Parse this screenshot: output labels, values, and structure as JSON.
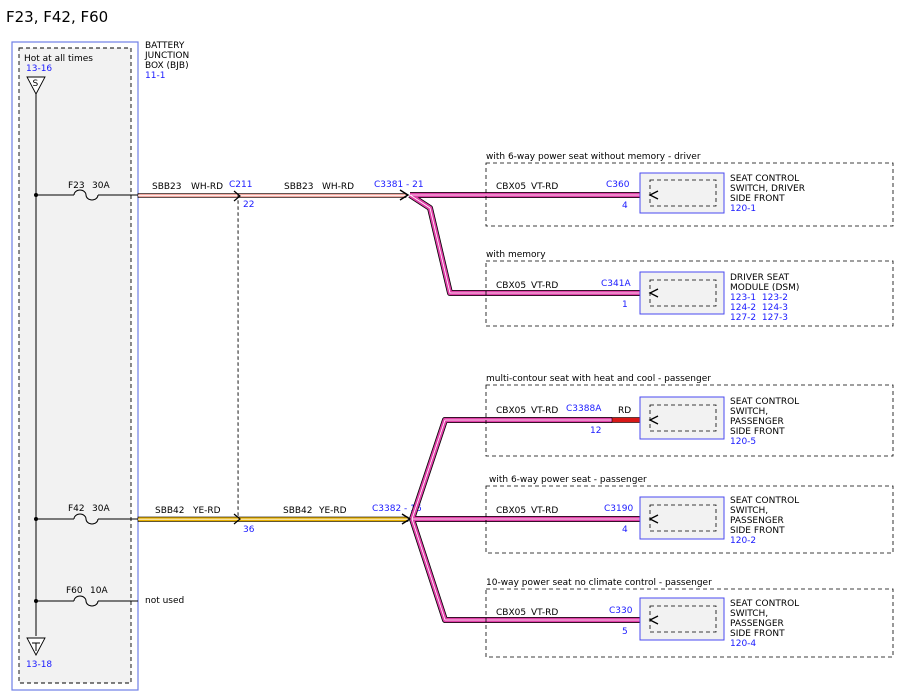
{
  "title": "F23, F42, F60",
  "bjb": {
    "hot_label": "Hot at all times",
    "ref_top": "13-16",
    "ref_bottom": "13-18",
    "s_label": "S",
    "name_lines": [
      "BATTERY",
      "JUNCTION",
      "BOX (BJB)"
    ],
    "name_ref": "11-1"
  },
  "fuses": [
    {
      "id": "F23",
      "amps": "30A"
    },
    {
      "id": "F42",
      "amps": "30A"
    },
    {
      "id": "F60",
      "amps": "10A",
      "note": "not used"
    }
  ],
  "circuits": {
    "top": {
      "left_circuit": "SBB23",
      "left_color": "WH-RD",
      "mid_connector": "C211",
      "mid_pin": "22",
      "right_circuit": "SBB23",
      "right_color": "WH-RD",
      "splice": "C3381 - 21"
    },
    "bottom": {
      "left_circuit": "SBB42",
      "left_color": "YE-RD",
      "mid_pin": "36",
      "right_circuit": "SBB42",
      "right_color": "YE-RD",
      "splice": "C3382 - 16"
    }
  },
  "branches": [
    {
      "condition": "with 6-way power seat without memory - driver",
      "circuit": "CBX05",
      "color": "VT-RD",
      "connector": "C360",
      "pin": "4",
      "device": [
        "SEAT CONTROL",
        "SWITCH, DRIVER",
        "SIDE FRONT"
      ],
      "refs": [
        "120-1"
      ]
    },
    {
      "condition": "with memory",
      "circuit": "CBX05",
      "color": "VT-RD",
      "connector": "C341A",
      "pin": "1",
      "device": [
        "DRIVER SEAT",
        "MODULE (DSM)"
      ],
      "refs": [
        "123-1  123-2",
        "124-2  124-3",
        "127-2  127-3"
      ]
    },
    {
      "condition": "multi-contour seat with heat and cool - passenger",
      "circuit": "CBX05",
      "color": "VT-RD",
      "connector": "C3388A",
      "pin": "12",
      "stub_color": "RD",
      "device": [
        "SEAT CONTROL",
        "SWITCH,",
        "PASSENGER",
        "SIDE FRONT"
      ],
      "refs": [
        "120-5"
      ]
    },
    {
      "condition": "with 6-way power seat - passenger",
      "circuit": "CBX05",
      "color": "VT-RD",
      "connector": "C3190",
      "pin": "4",
      "device": [
        "SEAT CONTROL",
        "SWITCH,",
        "PASSENGER",
        "SIDE FRONT"
      ],
      "refs": [
        "120-2"
      ]
    },
    {
      "condition": "10-way power seat no climate control - passenger",
      "circuit": "CBX05",
      "color": "VT-RD",
      "connector": "C330",
      "pin": "5",
      "device": [
        "SEAT CONTROL",
        "SWITCH,",
        "PASSENGER",
        "SIDE FRONT"
      ],
      "refs": [
        "120-4"
      ]
    }
  ],
  "colors": {
    "ref_blue": "#1a1aff",
    "border_blue": "#6f7fe6",
    "wire_violet_red": "#e040a8",
    "wire_white_red": "#f2a8a0",
    "wire_yellow_red": "#e8b000",
    "stub_red": "#d81818",
    "panel_fill": "#f2f2f2"
  }
}
